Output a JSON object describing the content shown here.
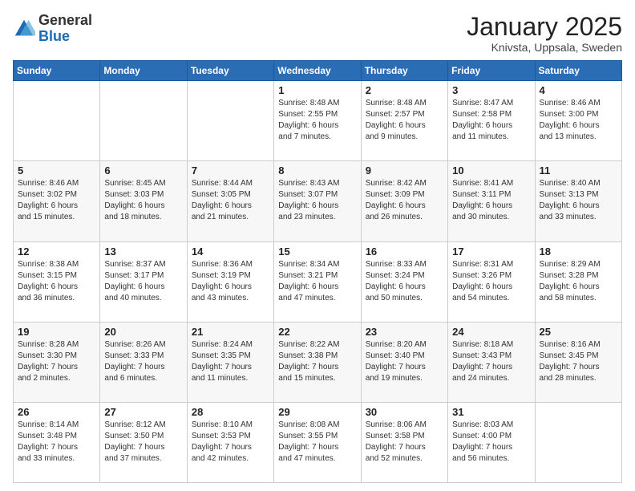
{
  "logo": {
    "general": "General",
    "blue": "Blue"
  },
  "header": {
    "title": "January 2025",
    "subtitle": "Knivsta, Uppsala, Sweden"
  },
  "days_of_week": [
    "Sunday",
    "Monday",
    "Tuesday",
    "Wednesday",
    "Thursday",
    "Friday",
    "Saturday"
  ],
  "weeks": [
    [
      {
        "day": "",
        "info": ""
      },
      {
        "day": "",
        "info": ""
      },
      {
        "day": "",
        "info": ""
      },
      {
        "day": "1",
        "info": "Sunrise: 8:48 AM\nSunset: 2:55 PM\nDaylight: 6 hours\nand 7 minutes."
      },
      {
        "day": "2",
        "info": "Sunrise: 8:48 AM\nSunset: 2:57 PM\nDaylight: 6 hours\nand 9 minutes."
      },
      {
        "day": "3",
        "info": "Sunrise: 8:47 AM\nSunset: 2:58 PM\nDaylight: 6 hours\nand 11 minutes."
      },
      {
        "day": "4",
        "info": "Sunrise: 8:46 AM\nSunset: 3:00 PM\nDaylight: 6 hours\nand 13 minutes."
      }
    ],
    [
      {
        "day": "5",
        "info": "Sunrise: 8:46 AM\nSunset: 3:02 PM\nDaylight: 6 hours\nand 15 minutes."
      },
      {
        "day": "6",
        "info": "Sunrise: 8:45 AM\nSunset: 3:03 PM\nDaylight: 6 hours\nand 18 minutes."
      },
      {
        "day": "7",
        "info": "Sunrise: 8:44 AM\nSunset: 3:05 PM\nDaylight: 6 hours\nand 21 minutes."
      },
      {
        "day": "8",
        "info": "Sunrise: 8:43 AM\nSunset: 3:07 PM\nDaylight: 6 hours\nand 23 minutes."
      },
      {
        "day": "9",
        "info": "Sunrise: 8:42 AM\nSunset: 3:09 PM\nDaylight: 6 hours\nand 26 minutes."
      },
      {
        "day": "10",
        "info": "Sunrise: 8:41 AM\nSunset: 3:11 PM\nDaylight: 6 hours\nand 30 minutes."
      },
      {
        "day": "11",
        "info": "Sunrise: 8:40 AM\nSunset: 3:13 PM\nDaylight: 6 hours\nand 33 minutes."
      }
    ],
    [
      {
        "day": "12",
        "info": "Sunrise: 8:38 AM\nSunset: 3:15 PM\nDaylight: 6 hours\nand 36 minutes."
      },
      {
        "day": "13",
        "info": "Sunrise: 8:37 AM\nSunset: 3:17 PM\nDaylight: 6 hours\nand 40 minutes."
      },
      {
        "day": "14",
        "info": "Sunrise: 8:36 AM\nSunset: 3:19 PM\nDaylight: 6 hours\nand 43 minutes."
      },
      {
        "day": "15",
        "info": "Sunrise: 8:34 AM\nSunset: 3:21 PM\nDaylight: 6 hours\nand 47 minutes."
      },
      {
        "day": "16",
        "info": "Sunrise: 8:33 AM\nSunset: 3:24 PM\nDaylight: 6 hours\nand 50 minutes."
      },
      {
        "day": "17",
        "info": "Sunrise: 8:31 AM\nSunset: 3:26 PM\nDaylight: 6 hours\nand 54 minutes."
      },
      {
        "day": "18",
        "info": "Sunrise: 8:29 AM\nSunset: 3:28 PM\nDaylight: 6 hours\nand 58 minutes."
      }
    ],
    [
      {
        "day": "19",
        "info": "Sunrise: 8:28 AM\nSunset: 3:30 PM\nDaylight: 7 hours\nand 2 minutes."
      },
      {
        "day": "20",
        "info": "Sunrise: 8:26 AM\nSunset: 3:33 PM\nDaylight: 7 hours\nand 6 minutes."
      },
      {
        "day": "21",
        "info": "Sunrise: 8:24 AM\nSunset: 3:35 PM\nDaylight: 7 hours\nand 11 minutes."
      },
      {
        "day": "22",
        "info": "Sunrise: 8:22 AM\nSunset: 3:38 PM\nDaylight: 7 hours\nand 15 minutes."
      },
      {
        "day": "23",
        "info": "Sunrise: 8:20 AM\nSunset: 3:40 PM\nDaylight: 7 hours\nand 19 minutes."
      },
      {
        "day": "24",
        "info": "Sunrise: 8:18 AM\nSunset: 3:43 PM\nDaylight: 7 hours\nand 24 minutes."
      },
      {
        "day": "25",
        "info": "Sunrise: 8:16 AM\nSunset: 3:45 PM\nDaylight: 7 hours\nand 28 minutes."
      }
    ],
    [
      {
        "day": "26",
        "info": "Sunrise: 8:14 AM\nSunset: 3:48 PM\nDaylight: 7 hours\nand 33 minutes."
      },
      {
        "day": "27",
        "info": "Sunrise: 8:12 AM\nSunset: 3:50 PM\nDaylight: 7 hours\nand 37 minutes."
      },
      {
        "day": "28",
        "info": "Sunrise: 8:10 AM\nSunset: 3:53 PM\nDaylight: 7 hours\nand 42 minutes."
      },
      {
        "day": "29",
        "info": "Sunrise: 8:08 AM\nSunset: 3:55 PM\nDaylight: 7 hours\nand 47 minutes."
      },
      {
        "day": "30",
        "info": "Sunrise: 8:06 AM\nSunset: 3:58 PM\nDaylight: 7 hours\nand 52 minutes."
      },
      {
        "day": "31",
        "info": "Sunrise: 8:03 AM\nSunset: 4:00 PM\nDaylight: 7 hours\nand 56 minutes."
      },
      {
        "day": "",
        "info": ""
      }
    ]
  ]
}
